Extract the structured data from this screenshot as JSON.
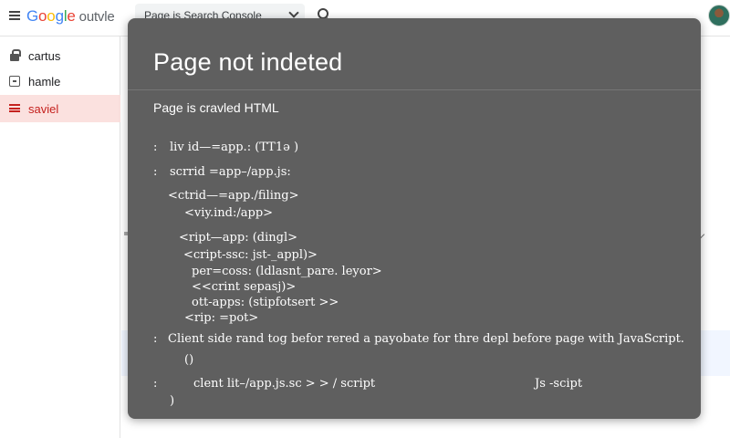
{
  "header": {
    "logo": {
      "letters": [
        "G",
        "o",
        "o",
        "g",
        "l",
        "e"
      ],
      "suffix": "outvle"
    },
    "property_select": "Page is Search Console"
  },
  "sidebar": {
    "items": [
      {
        "label": "cartus",
        "icon": "lock-icon",
        "active": false
      },
      {
        "label": "hamle",
        "icon": "box-icon",
        "active": false
      },
      {
        "label": "saviel",
        "icon": "list-icon",
        "active": true
      }
    ]
  },
  "colors": {
    "modal_bg": "#5f5f5f",
    "active_bg": "#fbe1df",
    "active_text": "#c5221f"
  },
  "modal": {
    "title": "Page not indeted",
    "subtitle": "Page is cravled HTML",
    "bullets": [
      ":",
      ":",
      ":",
      ":"
    ],
    "code_lines": [
      "liv id—=app.: (TT1ə )",
      "scrrid =app–/app.js:",
      "<ctrid—=app./filing>",
      "<viy.ind:/app>",
      "<ript—app: (dingl>",
      "<cript-ssc: jst-_appl)>",
      "per=coss: (ldlasnt_pare. leyor>",
      "<<crint sepasj)>",
      "ott-apps: (stipfotsert >>",
      "<rip: =pot>",
      "Client side rand tog befor rered a payobate for thre depl before page with  JavaScript.",
      "()",
      "clent lit–/app.js.sc > >  / script",
      "Js -scipt",
      ")"
    ]
  }
}
